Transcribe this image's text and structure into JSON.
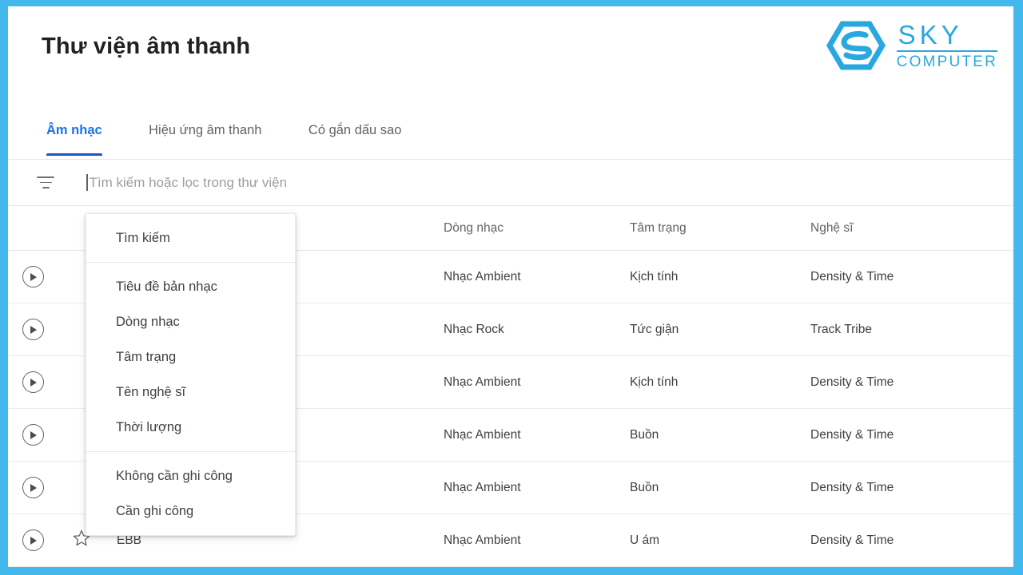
{
  "theme": {
    "border_blue": "#43b8ec",
    "accent_blue": "#1a73e8",
    "tab_underline": "#1a56c4",
    "logo_blue": "#29a8e0"
  },
  "header": {
    "title": "Thư viện âm thanh",
    "logo": {
      "primary": "SKY",
      "secondary": "COMPUTER",
      "mark": "sky-s-hexagon-logo"
    }
  },
  "tabs": [
    {
      "label": "Âm nhạc",
      "active": true
    },
    {
      "label": "Hiệu ứng âm thanh",
      "active": false
    },
    {
      "label": "Có gắn dấu sao",
      "active": false
    }
  ],
  "search": {
    "filter_icon": "filter-lines-icon",
    "value": "",
    "placeholder": "Tìm kiếm hoặc lọc trong thư viện"
  },
  "dropdown": {
    "groups": [
      {
        "items": [
          {
            "label": "Tìm kiếm"
          }
        ]
      },
      {
        "items": [
          {
            "label": "Tiêu đề bản nhạc"
          },
          {
            "label": "Dòng nhạc"
          },
          {
            "label": "Tâm trạng"
          },
          {
            "label": "Tên nghệ sĩ"
          },
          {
            "label": "Thời lượng"
          }
        ]
      },
      {
        "items": [
          {
            "label": "Không cần ghi công"
          },
          {
            "label": "Cần ghi công"
          }
        ]
      }
    ]
  },
  "table": {
    "columns": {
      "title": "",
      "genre": "Dòng nhạc",
      "mood": "Tâm trạng",
      "artist": "Nghệ sĩ"
    },
    "rows": [
      {
        "title": "",
        "genre": "Nhạc Ambient",
        "mood": "Kịch tính",
        "artist": "Density & Time",
        "starred": false
      },
      {
        "title": "",
        "genre": "Nhạc Rock",
        "mood": "Tức giận",
        "artist": "Track Tribe",
        "starred": false
      },
      {
        "title": "",
        "genre": "Nhạc Ambient",
        "mood": "Kịch tính",
        "artist": "Density & Time",
        "starred": false
      },
      {
        "title": "",
        "genre": "Nhạc Ambient",
        "mood": "Buồn",
        "artist": "Density & Time",
        "starred": false
      },
      {
        "title": "",
        "genre": "Nhạc Ambient",
        "mood": "Buồn",
        "artist": "Density & Time",
        "starred": false
      },
      {
        "title": "EBB",
        "genre": "Nhạc Ambient",
        "mood": "U ám",
        "artist": "Density & Time",
        "starred": false
      }
    ]
  }
}
